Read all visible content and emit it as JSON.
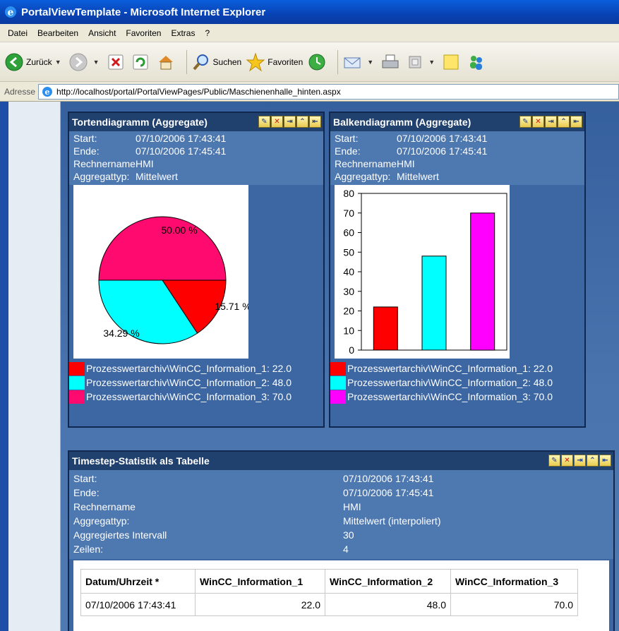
{
  "window": {
    "title": "PortalViewTemplate - Microsoft Internet Explorer"
  },
  "menu": [
    "Datei",
    "Bearbeiten",
    "Ansicht",
    "Favoriten",
    "Extras",
    "?"
  ],
  "toolbar": {
    "back": "Zurück",
    "search": "Suchen",
    "favorites": "Favoriten"
  },
  "address": {
    "label": "Adresse",
    "url": "http://localhost/portal/PortalViewPages/Public/Maschienenhalle_hinten.aspx"
  },
  "colors": {
    "red": "#ff0000",
    "cyan": "#00ffff",
    "magenta": "#ff00ff",
    "pink": "#ff0a6e"
  },
  "pie_panel": {
    "title": "Tortendiagramm (Aggregate)",
    "info": [
      {
        "k": "Start:",
        "v": "07/10/2006 17:43:41"
      },
      {
        "k": "Ende:",
        "v": "07/10/2006 17:45:41"
      },
      {
        "k": "Rechnername",
        "v": "HMI"
      },
      {
        "k": "Aggregattyp:",
        "v": "Mittelwert"
      }
    ],
    "legend": [
      "Prozesswertarchiv\\WinCC_Information_1: 22.0",
      "Prozesswertarchiv\\WinCC_Information_2: 48.0",
      "Prozesswertarchiv\\WinCC_Information_3: 70.0"
    ]
  },
  "bar_panel": {
    "title": "Balkendiagramm (Aggregate)",
    "info": [
      {
        "k": "Start:",
        "v": "07/10/2006 17:43:41"
      },
      {
        "k": "Ende:",
        "v": "07/10/2006 17:45:41"
      },
      {
        "k": "Rechnername",
        "v": "HMI"
      },
      {
        "k": "Aggregattyp:",
        "v": "Mittelwert"
      }
    ],
    "legend": [
      "Prozesswertarchiv\\WinCC_Information_1: 22.0",
      "Prozesswertarchiv\\WinCC_Information_2: 48.0",
      "Prozesswertarchiv\\WinCC_Information_3: 70.0"
    ]
  },
  "chart_data": [
    {
      "type": "pie",
      "labels": [
        "Prozesswertarchiv\\WinCC_Information_1",
        "Prozesswertarchiv\\WinCC_Information_2",
        "Prozesswertarchiv\\WinCC_Information_3"
      ],
      "values": [
        22.0,
        48.0,
        70.0
      ],
      "slice_labels": [
        "15.71 %",
        "34.29 %",
        "50.00 %"
      ],
      "colors": [
        "#ff0000",
        "#00ffff",
        "#ff0a6e"
      ]
    },
    {
      "type": "bar",
      "categories": [
        "Prozesswertarchiv\\WinCC_Information_1",
        "Prozesswertarchiv\\WinCC_Information_2",
        "Prozesswertarchiv\\WinCC_Information_3"
      ],
      "values": [
        22.0,
        48.0,
        70.0
      ],
      "ylim": [
        0,
        80
      ],
      "yticks": [
        "0",
        "10",
        "20",
        "30",
        "40",
        "50",
        "60",
        "70",
        "80"
      ],
      "colors": [
        "#ff0000",
        "#00ffff",
        "#ff00ff"
      ],
      "grid": false
    }
  ],
  "table_panel": {
    "title": "Timestep-Statistik als Tabelle",
    "info": [
      {
        "k": "Start:",
        "v": "07/10/2006 17:43:41"
      },
      {
        "k": "Ende:",
        "v": "07/10/2006 17:45:41"
      },
      {
        "k": "Rechnername",
        "v": "HMI"
      },
      {
        "k": "Aggregattyp:",
        "v": "Mittelwert (interpoliert)"
      },
      {
        "k": "Aggregiertes Intervall",
        "v": "30"
      },
      {
        "k": "Zeilen:",
        "v": "4"
      }
    ],
    "headers": [
      "Datum/Uhrzeit *",
      "WinCC_Information_1",
      "WinCC_Information_2",
      "WinCC_Information_3"
    ],
    "rows": [
      [
        "07/10/2006 17:43:41",
        "22.0",
        "48.0",
        "70.0"
      ]
    ]
  }
}
